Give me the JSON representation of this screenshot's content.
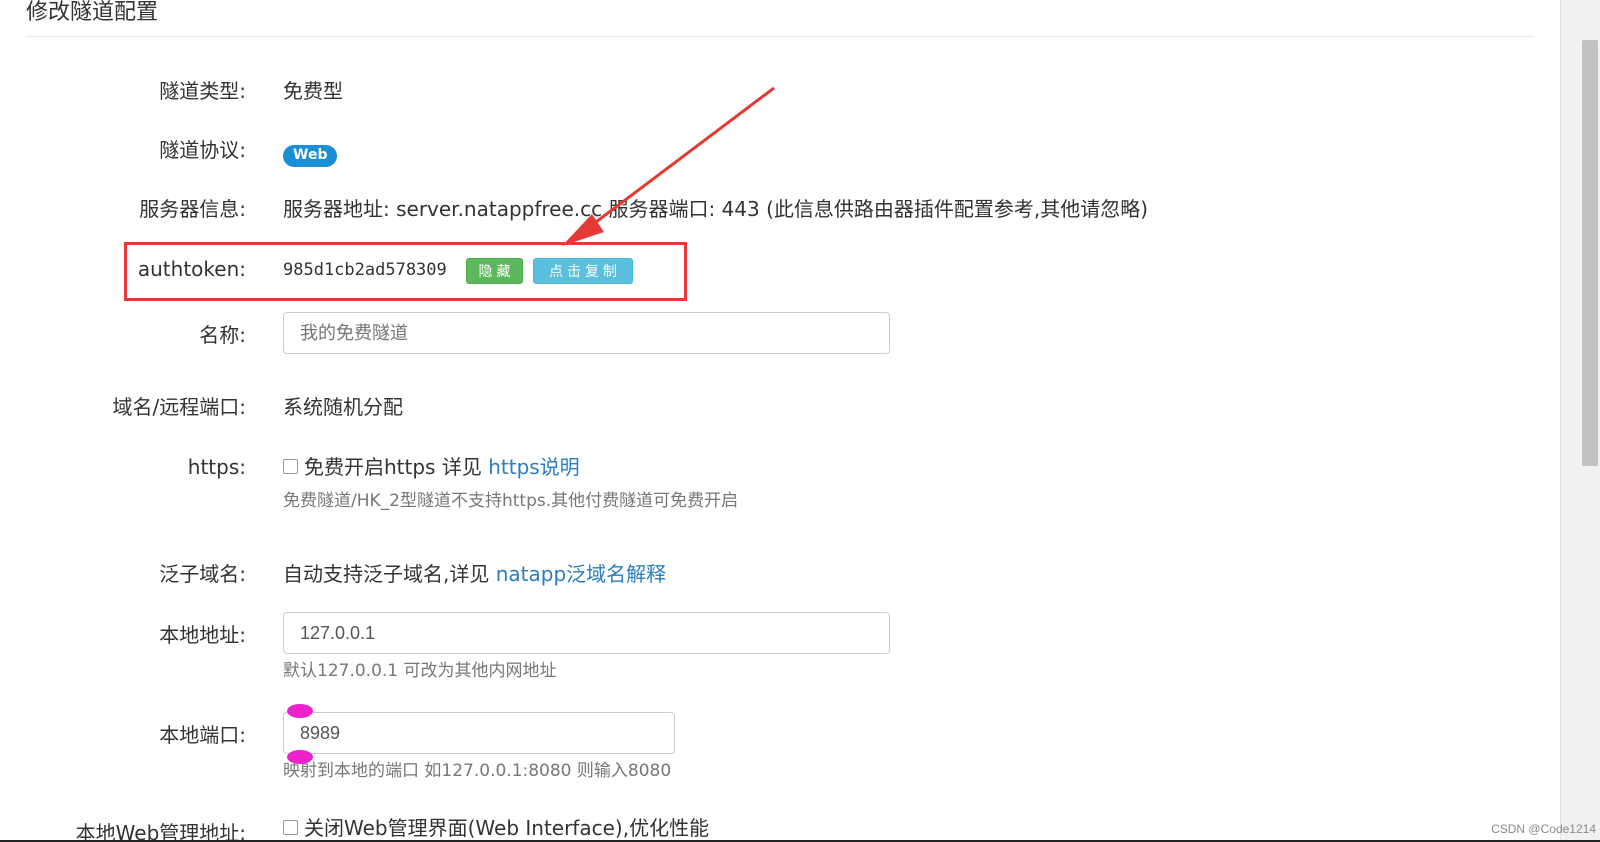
{
  "page_title": "修改隧道配置",
  "rows": {
    "tunnel_type": {
      "label": "隧道类型:",
      "value": "免费型"
    },
    "tunnel_protocol": {
      "label": "隧道协议:",
      "badge": "Web"
    },
    "server_info": {
      "label": "服务器信息:",
      "value": "服务器地址: server.natappfree.cc 服务器端口: 443 (此信息供路由器插件配置参考,其他请忽略)"
    },
    "authtoken": {
      "label": "authtoken:",
      "value": "985d1cb2ad578309",
      "hide_button": "隐藏",
      "copy_button": "点击复制"
    },
    "name": {
      "label": "名称:",
      "placeholder": "我的免费隧道"
    },
    "domain": {
      "label": "域名/远程端口:",
      "value": "系统随机分配"
    },
    "https": {
      "label": "https:",
      "checkbox_label": "免费开启https 详见",
      "link": "https说明",
      "help": "免费隧道/HK_2型隧道不支持https.其他付费隧道可免费开启"
    },
    "wildcard": {
      "label": "泛子域名:",
      "value": "自动支持泛子域名,详见",
      "link": "natapp泛域名解释"
    },
    "local_address": {
      "label": "本地地址:",
      "value": "127.0.0.1",
      "help": "默认127.0.0.1 可改为其他内网地址"
    },
    "local_port": {
      "label": "本地端口:",
      "value": "8989",
      "help": "映射到本地的端口 如127.0.0.1:8080 则输入8080"
    },
    "web_admin": {
      "label": "本地Web管理地址:",
      "checkbox_label": "关闭Web管理界面(Web Interface),优化性能"
    }
  },
  "watermark": "CSDN @Code1214",
  "colors": {
    "highlight": "#e53935",
    "badge": "#1b8fd6",
    "hide_button": "#5cb85c",
    "copy_button": "#5bc0de",
    "link": "#2a7dc1",
    "marker": "#ee22cc"
  }
}
